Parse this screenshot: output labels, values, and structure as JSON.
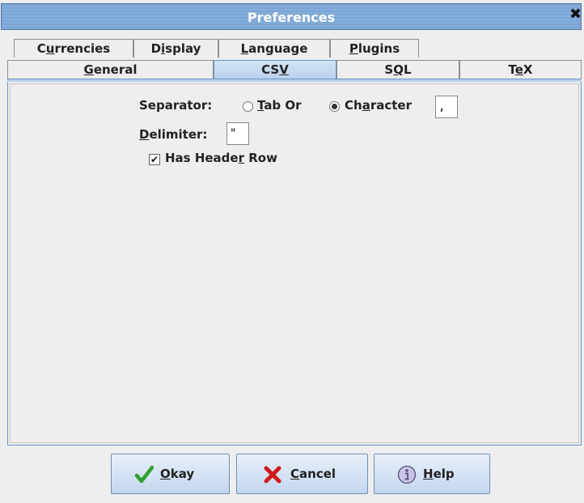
{
  "window": {
    "title": "Preferences",
    "close_glyph": "✖"
  },
  "tabs_row1": [
    {
      "pre": "C",
      "u": "u",
      "post": "rrencies"
    },
    {
      "pre": "D",
      "u": "i",
      "post": "splay"
    },
    {
      "pre": "",
      "u": "L",
      "post": "anguage"
    },
    {
      "pre": "",
      "u": "P",
      "post": "lugins"
    }
  ],
  "tabs_row2": [
    {
      "pre": "",
      "u": "G",
      "post": "eneral"
    },
    {
      "pre": "CS",
      "u": "V",
      "post": ""
    },
    {
      "pre": "S",
      "u": "Q",
      "post": "L"
    },
    {
      "pre": "T",
      "u": "e",
      "post": "X"
    }
  ],
  "selected_tab": "CSV",
  "csv": {
    "separator_label": "Separator:",
    "tab_pre": "",
    "tab_u": "T",
    "tab_post": "ab Or",
    "char_pre": "Ch",
    "char_u": "a",
    "char_post": "racter",
    "separator_mode": "character",
    "separator_value": ",",
    "delimiter_pre": "",
    "delimiter_u": "D",
    "delimiter_post": "elimiter:",
    "delimiter_value": "\"",
    "header_pre": "Has Heade",
    "header_u": "r",
    "header_post": " Row",
    "has_header": true
  },
  "buttons": {
    "okay": {
      "pre": "",
      "u": "O",
      "post": "kay",
      "icon": "checkmark-icon"
    },
    "cancel": {
      "pre": "",
      "u": "C",
      "post": "ancel",
      "icon": "x-icon"
    },
    "help": {
      "pre": "",
      "u": "H",
      "post": "elp",
      "icon": "info-icon"
    }
  },
  "colors": {
    "accent": "#7ba5d4",
    "selected_tab": "#b9d0ec",
    "ok_green": "#2ea02e",
    "cancel_red": "#d11a1a"
  }
}
